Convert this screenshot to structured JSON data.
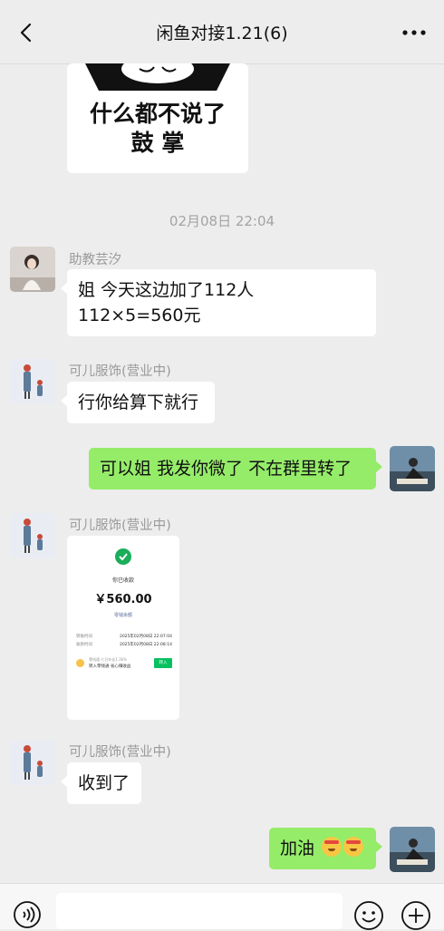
{
  "header": {
    "title": "闲鱼对接1.21(6)",
    "back_icon": "chevron-left-icon",
    "more_icon": "more-dots-icon"
  },
  "sticker": {
    "line1": "什么都不说了",
    "line2": "鼓 掌"
  },
  "timestamp": "02月08日 22:04",
  "messages": [
    {
      "sender": "助教芸汐",
      "lines": [
        "姐 今天这边加了112人",
        "112×5=560元"
      ]
    },
    {
      "sender": "可儿服饰(营业中)",
      "lines": [
        "行你给算下就行"
      ]
    },
    {
      "text": "可以姐 我发你微了 不在群里转了"
    },
    {
      "sender": "可儿服饰(营业中)",
      "payment": {
        "status": "你已收款",
        "amount": "￥560.00",
        "link": "零钱余额",
        "row1_label": "转账时间",
        "row1_value": "2025年02月08日 22:07:04",
        "row2_label": "收款时间",
        "row2_value": "2025年02月08日 22:08:14",
        "promo_title": "零钱通 七日年化1.36%",
        "promo_sub": "转入零钱通 省心赚收益",
        "promo_button": "转入"
      }
    },
    {
      "sender": "可儿服饰(营业中)",
      "lines": [
        "收到了"
      ]
    },
    {
      "text": "加油",
      "emoji_count": 2
    }
  ],
  "input": {
    "placeholder": ""
  },
  "colors": {
    "background": "#ededed",
    "outgoing_bubble": "#95ec69",
    "incoming_bubble": "#ffffff",
    "wechat_green": "#07c160"
  },
  "icons": {
    "voice": "voice-icon",
    "emoji": "emoji-icon",
    "plus": "plus-circle-icon"
  }
}
